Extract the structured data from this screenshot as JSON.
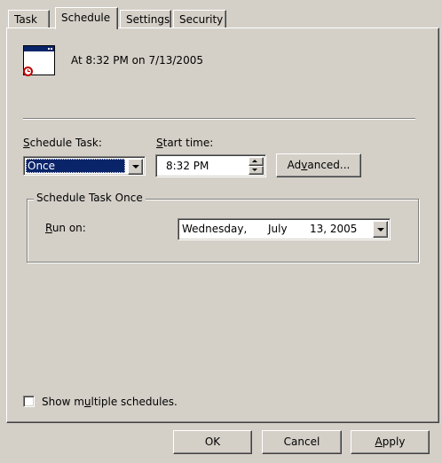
{
  "tabs": [
    {
      "label": "Task"
    },
    {
      "label": "Schedule"
    },
    {
      "label": "Settings"
    },
    {
      "label": "Security"
    }
  ],
  "summary": {
    "text": "At 8:32 PM on 7/13/2005",
    "icon": "scheduled-task-icon"
  },
  "schedule_task": {
    "label_u": "S",
    "label_rest": "chedule Task:",
    "value": "Once"
  },
  "start_time": {
    "label_u": "S",
    "label_rest": "tart time:",
    "value": "8:32 PM"
  },
  "advanced": {
    "pre": "Ad",
    "u": "v",
    "post": "anced..."
  },
  "group": {
    "title": "Schedule Task Once"
  },
  "run_on": {
    "label_u": "R",
    "label_rest": "un on:",
    "weekday": "Wednesday,",
    "month": "July",
    "day_year": "13, 2005"
  },
  "show_multiple": {
    "pre": "Show m",
    "u": "u",
    "post": "ltiple schedules.",
    "checked": false
  },
  "footer": {
    "ok": "OK",
    "cancel": "Cancel",
    "apply_u": "A",
    "apply_rest": "pply"
  },
  "colors": {
    "face": "#d4d0c8",
    "highlight": "#0a246a",
    "highlight_text": "#ffffff"
  }
}
